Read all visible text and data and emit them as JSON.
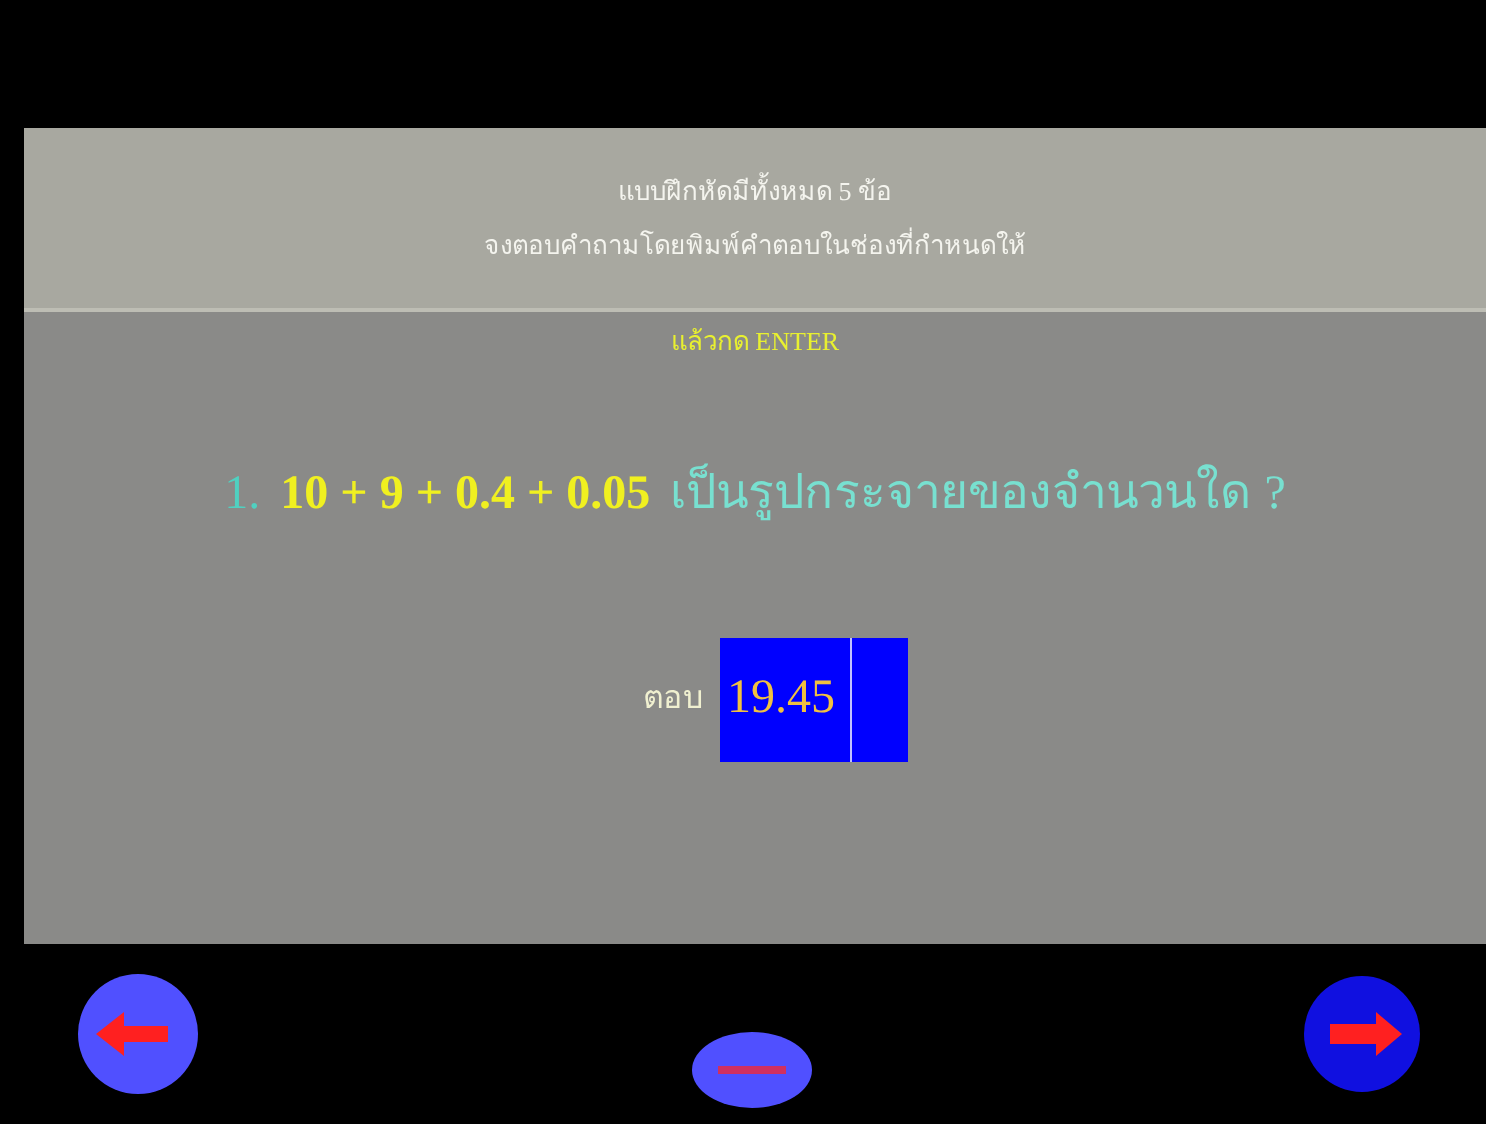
{
  "header": {
    "lines": [
      "แบบฝึกหัดมีทั้งหมด 5 ข้อ",
      "จงตอบคำถามโดยพิมพ์คำตอบในช่องที่กำหนดให้"
    ]
  },
  "instruction": "แล้วกด ENTER",
  "question": {
    "number": "1.",
    "expression": "10 + 9 + 0.4 + 0.05",
    "text": "เป็นรูปกระจายของจำนวนใด ?"
  },
  "answer": {
    "label": "ตอบ",
    "value": "19.45"
  },
  "nav_buttons": [
    {
      "kind": "back"
    },
    {
      "kind": "home"
    },
    {
      "kind": "next"
    }
  ]
}
